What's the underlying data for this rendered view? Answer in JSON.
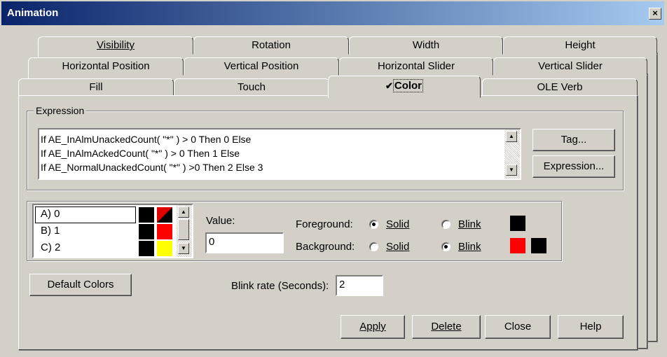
{
  "window": {
    "title": "Animation",
    "close_glyph": "×"
  },
  "tabs": {
    "row1": [
      "Visibility",
      "Rotation",
      "Width",
      "Height"
    ],
    "row2": [
      "Horizontal Position",
      "Vertical Position",
      "Horizontal Slider",
      "Vertical Slider"
    ],
    "row3": [
      "Fill",
      "Touch",
      "Color",
      "OLE Verb"
    ],
    "active": "Color",
    "active_check": "✔"
  },
  "expression": {
    "label": "Expression",
    "lines": [
      "If AE_InAlmUnackedCount( \"*\" ) > 0 Then 0 Else",
      "If AE_InAlmAckedCount( \"*\" ) > 0 Then 1 Else",
      "If AE_NormalUnackedCount( \"*\" ) >0 Then 2 Else 3"
    ],
    "tag_button": "Tag...",
    "expression_button": "Expression..."
  },
  "color_list": {
    "items": [
      {
        "label": "A) 0",
        "fg": "#000000",
        "bg": "#e00000",
        "blink": "half"
      },
      {
        "label": "B) 1",
        "fg": "#000000",
        "bg": "#ff0000",
        "blink": ""
      },
      {
        "label": "C) 2",
        "fg": "#000000",
        "bg": "#ffff00",
        "blink": ""
      }
    ]
  },
  "value": {
    "label": "Value:",
    "input": "0"
  },
  "foreground": {
    "label": "Foreground:",
    "solid": "Solid",
    "blink": "Blink",
    "selected": "Solid",
    "swatch": "#000000"
  },
  "background": {
    "label": "Background:",
    "solid": "Solid",
    "blink": "Blink",
    "selected": "Blink",
    "swatch_primary": "#ff0000",
    "swatch_blink": "#000000"
  },
  "default_colors_button": "Default Colors",
  "blink_rate": {
    "label": "Blink rate (Seconds):",
    "value": "2"
  },
  "buttons": {
    "apply": "Apply",
    "delete": "Delete",
    "close": "Close",
    "help": "Help"
  }
}
